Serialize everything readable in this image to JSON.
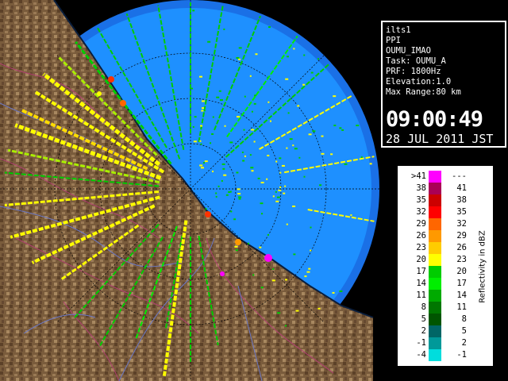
{
  "info": {
    "radar_name": "ilts1",
    "scan_type": "PPI",
    "site": "OUMU_IMAO",
    "task": "Task: OUMU_A",
    "prf": "PRF: 1800Hz",
    "elevation": "Elevation:1.0",
    "max_range": "Max Range:80 km",
    "time": "09:00:49",
    "date": "28 JUL 2011 JST"
  },
  "legend": {
    "title": "Reflectivity in dBZ",
    "rows": [
      {
        "low": ">41",
        "high": "---",
        "color": "#ff00ff"
      },
      {
        "low": "38",
        "high": "41",
        "color": "#aa0055"
      },
      {
        "low": "35",
        "high": "38",
        "color": "#cc0000"
      },
      {
        "low": "32",
        "high": "35",
        "color": "#ff0000"
      },
      {
        "low": "29",
        "high": "32",
        "color": "#ff6600"
      },
      {
        "low": "26",
        "high": "29",
        "color": "#ff9900"
      },
      {
        "low": "23",
        "high": "26",
        "color": "#ffcc00"
      },
      {
        "low": "20",
        "high": "23",
        "color": "#ffff00"
      },
      {
        "low": "17",
        "high": "20",
        "color": "#00cc00"
      },
      {
        "low": "14",
        "high": "17",
        "color": "#00ee00"
      },
      {
        "low": "11",
        "high": "14",
        "color": "#00aa00"
      },
      {
        "low": "8",
        "high": "11",
        "color": "#007700"
      },
      {
        "low": "5",
        "high": "8",
        "color": "#005500"
      },
      {
        "low": "2",
        "high": "5",
        "color": "#006666"
      },
      {
        "low": "-1",
        "high": "2",
        "color": "#009999"
      },
      {
        "low": "-4",
        "high": "-1",
        "color": "#00dddd"
      }
    ]
  },
  "colors": {
    "sea": "#1e90ff",
    "outer_sea": "#1a70e6",
    "land": "#7a5c3c",
    "background": "#000000"
  }
}
